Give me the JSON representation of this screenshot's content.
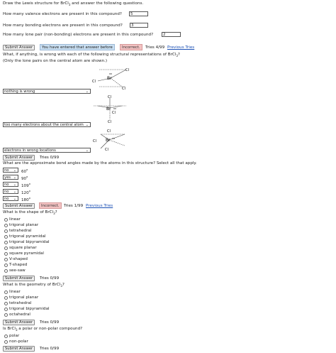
{
  "intro": {
    "pre": "Draw the Lewis structure for BrCl",
    "sub": "3",
    "post": " and answer the following questions."
  },
  "q1": {
    "label": "How many valence electrons are present in this compound?",
    "value": "5"
  },
  "q2": {
    "label": "How many bonding electrons are present in this compound?",
    "value": "3"
  },
  "q3": {
    "label": "How many lone pair (non-bonding) electrons are present in this compound?",
    "value": "2"
  },
  "submit_label": "Submit Answer",
  "feedback1": {
    "entered": "You have entered that answer before",
    "incorrect": "Incorrect.",
    "tries": "Tries 4/99",
    "prev": "Previous Tries"
  },
  "wrong_q": {
    "line1_pre": "What, if anything, is wrong with each of the following structural representations of BrCl",
    "line1_sub": "3",
    "line1_post": "?",
    "line2": "(Only the lone pairs on the central atom are shown.)"
  },
  "structures": {
    "atoms": {
      "br": "Br",
      "cl": "Cl"
    },
    "select1": "nothing is wrong",
    "select2": "too many electrons about the central atom",
    "select3": "electrons in wrong locations",
    "tries": "Tries 0/99"
  },
  "angles": {
    "question": "What are the approximate bond angles made by the atoms in this structure? Select all that apply.",
    "degree_symbol": "o",
    "items": [
      {
        "select": "no",
        "value": "60"
      },
      {
        "select": "yes",
        "value": "90"
      },
      {
        "select": "no",
        "value": "109"
      },
      {
        "select": "no",
        "value": "120"
      },
      {
        "select": "no",
        "value": "180"
      }
    ],
    "incorrect": "Incorrect.",
    "tries": "Tries 1/99",
    "prev": "Previous Tries"
  },
  "shape": {
    "q_pre": "What is the shape of BrCl",
    "q_sub": "3",
    "q_post": "?",
    "options": [
      "linear",
      "trigonal planar",
      "tetrahedral",
      "trigonal pyramidal",
      "trigonal bipyramidal",
      "square planar",
      "square pyramidal",
      "V-shaped",
      "T-shaped",
      "see-saw"
    ],
    "tries": "Tries 0/99"
  },
  "geometry": {
    "q_pre": "What is the geometry of BrCl",
    "q_sub": "3",
    "q_post": "?",
    "options": [
      "linear",
      "trigonal planar",
      "tetrahedral",
      "trigonal bipyramidal",
      "octahedral"
    ],
    "tries": "Tries 0/99"
  },
  "polarity": {
    "q_pre": "Is BrCl",
    "q_sub": "3",
    "q_post": " a polar or non-polar compound?",
    "options": [
      "polar",
      "non-polar"
    ],
    "tries": "Tries 0/99"
  }
}
